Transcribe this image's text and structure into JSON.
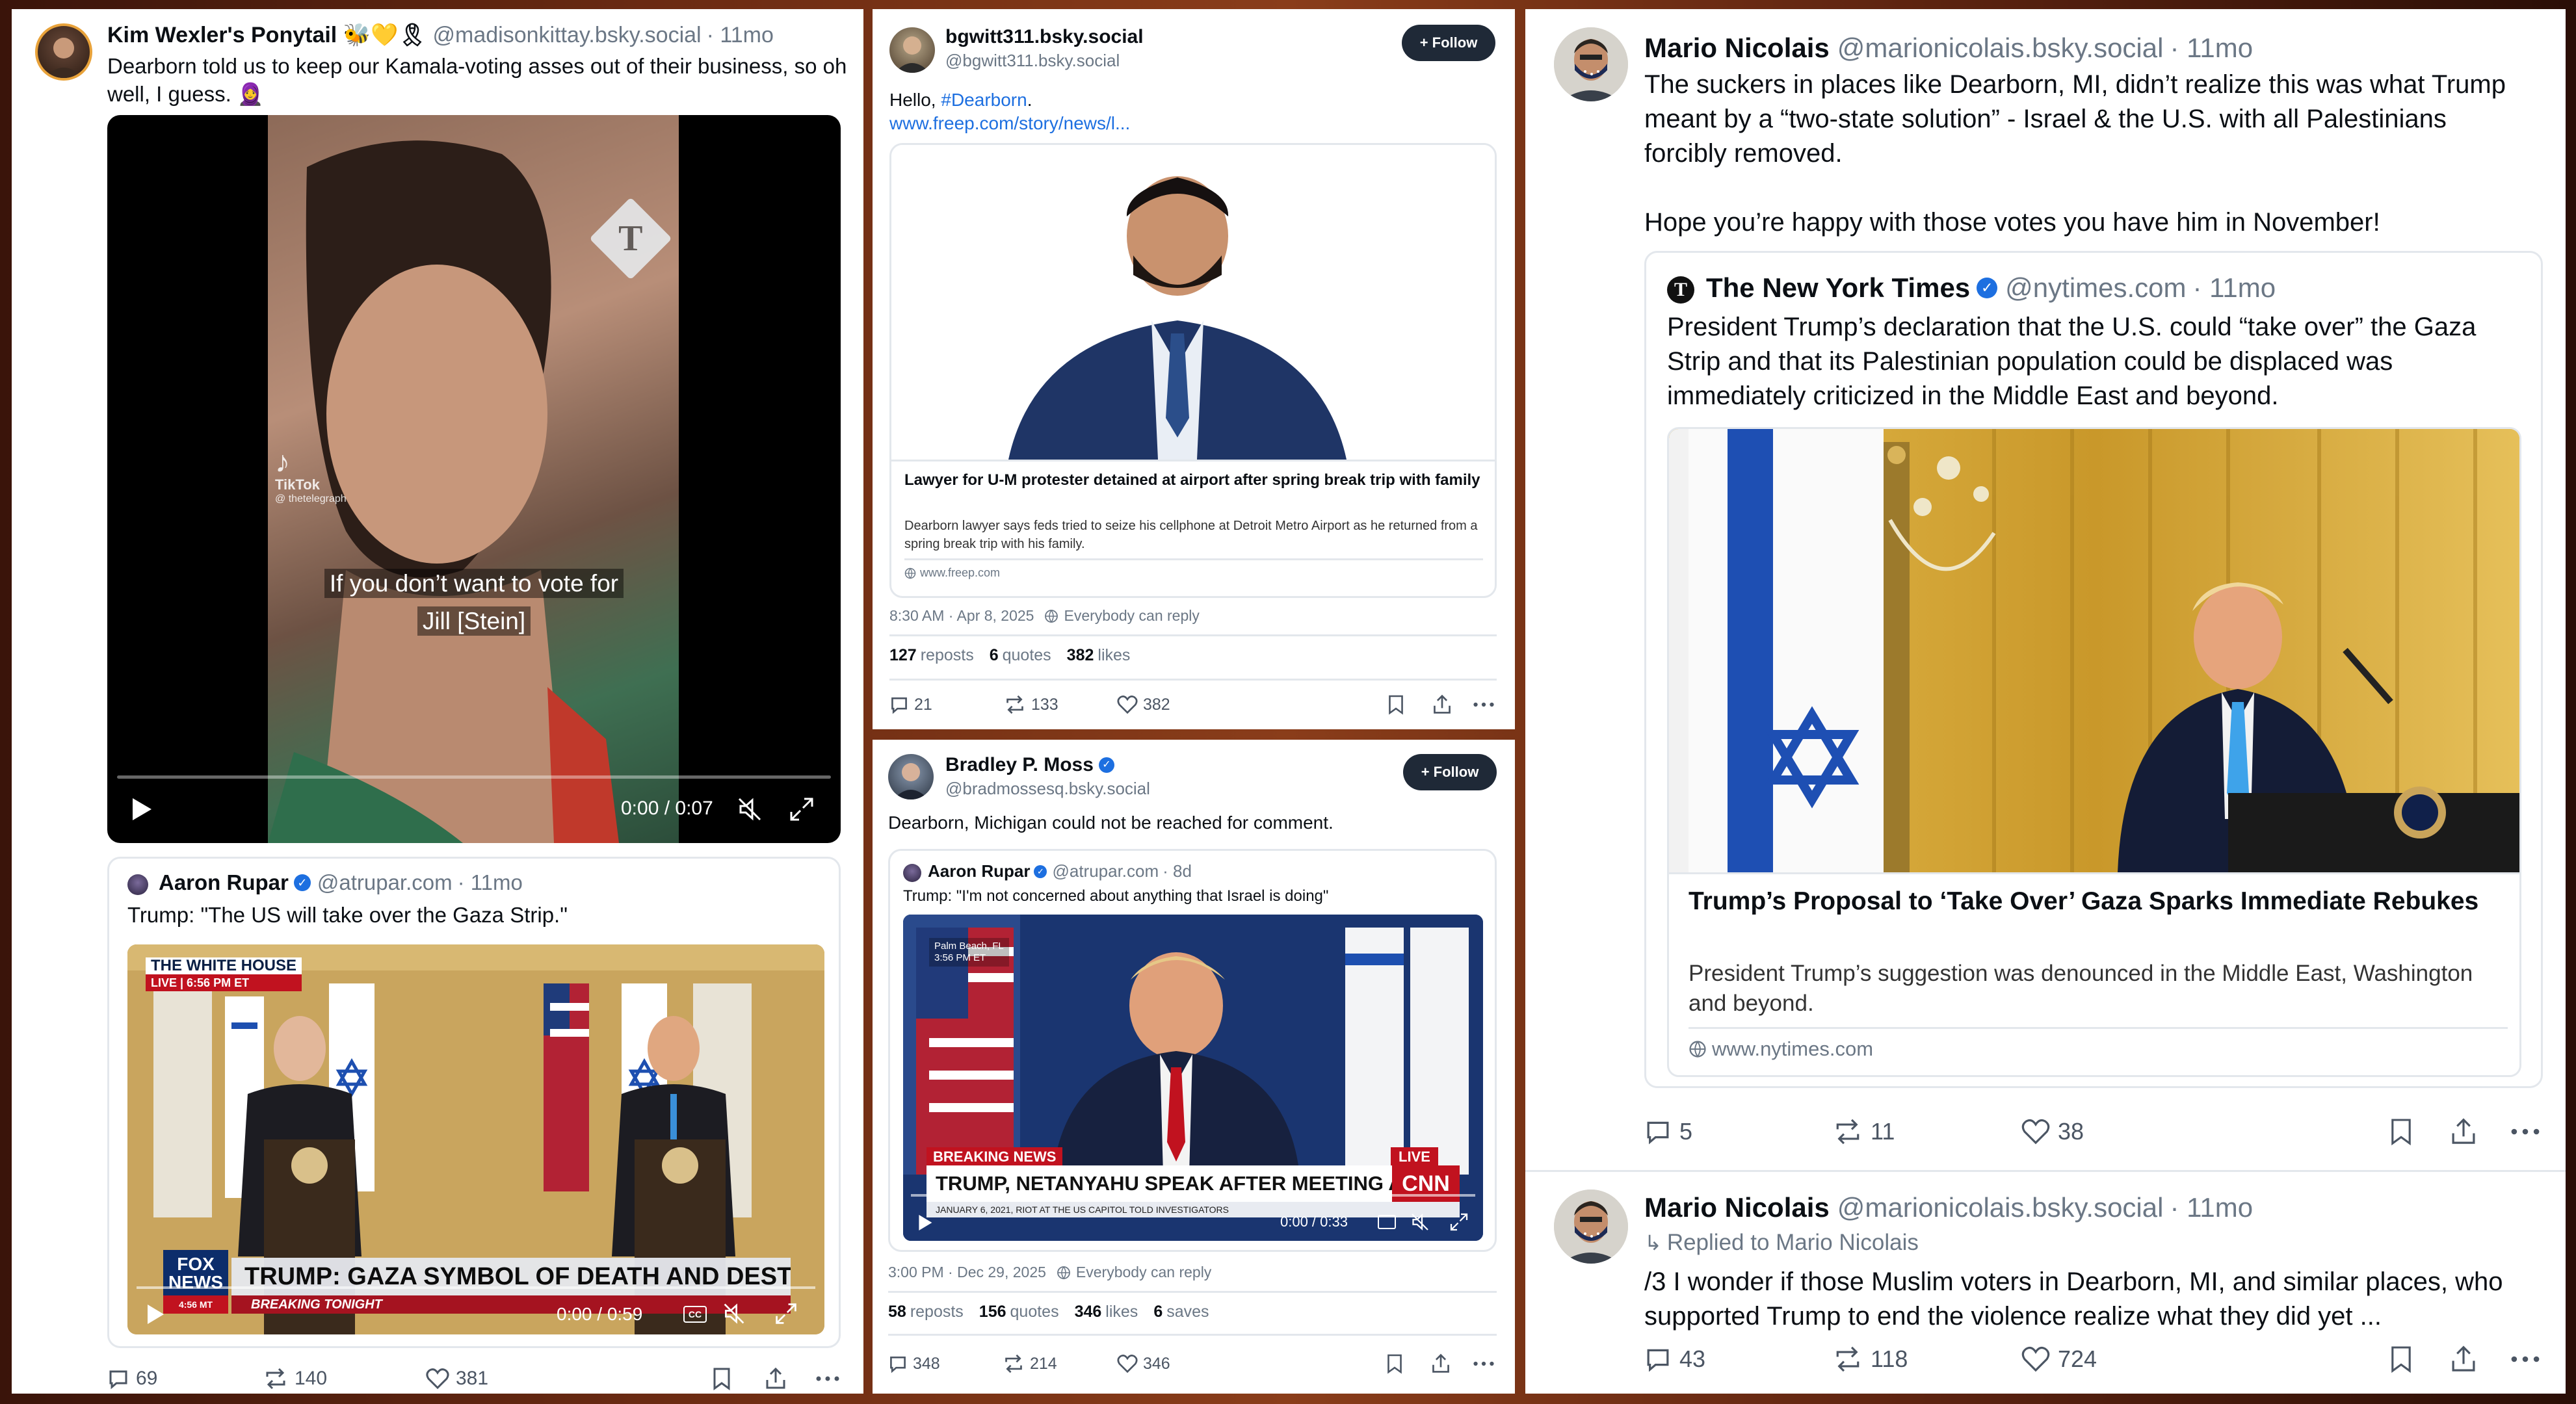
{
  "post1": {
    "author_name": "Kim Wexler's Ponytail 🐝💛🎗",
    "handle": "@madisonkittay.bsky.social",
    "time": "· 11mo",
    "text": "Dearborn told us to keep our Kamala-voting asses out of their business, so oh well, I guess. 🧕",
    "video": {
      "caption_line1": "If you don’t want to vote for",
      "caption_line2": "Jill [Stein]",
      "tiktok_label": "TikTok",
      "tiktok_user": "@ thetelegraph",
      "time_display": "0:00 / 0:07",
      "progress_fraction": 0.0
    }
  },
  "post2": {
    "author_name": "Aaron Rupar",
    "handle": "@atrupar.com",
    "time": "· 11mo",
    "text": "Trump: \"The US will take over the Gaza Strip.\"",
    "video": {
      "chyron_top": "THE WHITE HOUSE",
      "chyron_live": "LIVE | 6:56 PM ET",
      "network": "FOX NEWS",
      "network_time": "4:56 MT",
      "headline": "TRUMP: GAZA SYMBOL OF DEATH AND DESTRUCTION",
      "ticker": "BREAKING TONIGHT",
      "time_display": "0:00 / 0:59",
      "cc": "CC"
    },
    "stats": {
      "replies": "69",
      "reposts": "140",
      "likes": "381"
    }
  },
  "post3": {
    "author_name": "bgwitt311.bsky.social",
    "handle": "@bgwitt311.bsky.social",
    "follow_label": "+ Follow",
    "text_prefix": "Hello, ",
    "hashtag": "#Dearborn",
    "text_suffix": ".",
    "link": "www.freep.com/story/news/l...",
    "card": {
      "title": "Lawyer for U-M protester detained at airport after spring break trip with family",
      "description": "Dearborn lawyer says feds tried to seize his cellphone at Detroit Metro Airport as he returned from a spring break trip with his family.",
      "domain": "www.freep.com"
    },
    "timestamp": "8:30 AM · Apr 8, 2025",
    "reply_setting": "Everybody can reply",
    "counts": {
      "reposts": "127",
      "reposts_label": "reposts",
      "quotes": "6",
      "quotes_label": "quotes",
      "likes": "382",
      "likes_label": "likes"
    },
    "stats": {
      "replies": "21",
      "reposts": "133",
      "likes": "382"
    }
  },
  "post4": {
    "author_name": "Bradley P. Moss",
    "handle": "@bradmossesq.bsky.social",
    "follow_label": "+ Follow",
    "text": "Dearborn, Michigan could not be reached for comment.",
    "quote": {
      "author_name": "Aaron Rupar",
      "handle": "@atrupar.com",
      "time": "· 8d",
      "text": "Trump: \"I'm not concerned about anything that Israel is doing\"",
      "video": {
        "location": "Palm Beach, FL",
        "location_time": "3:56 PM ET",
        "breaking": "BREAKING NEWS",
        "live": "LIVE",
        "headline": "TRUMP, NETANYAHU SPEAK AFTER MEETING AT MAR-A-LAGO",
        "network": "CNN",
        "ticker": "JANUARY 6, 2021, RIOT AT THE US CAPITOL TOLD INVESTIGATORS",
        "time_display": "0:00 / 0:33"
      }
    },
    "timestamp": "3:00 PM · Dec 29, 2025",
    "reply_setting": "Everybody can reply",
    "counts": {
      "reposts": "58",
      "reposts_label": "reposts",
      "quotes": "156",
      "quotes_label": "quotes",
      "likes": "346",
      "likes_label": "likes",
      "saves": "6",
      "saves_label": "saves"
    },
    "stats": {
      "replies": "348",
      "reposts": "214",
      "likes": "346"
    }
  },
  "post5": {
    "author_name": "Mario Nicolais",
    "handle": "@marionicolais.bsky.social",
    "time": "· 11mo",
    "text1": "The suckers in places like Dearborn, MI, didn’t realize this was what Trump meant by a “two-state solution” - Israel & the U.S. with all Palestinians forcibly removed.",
    "text2": "Hope you’re happy with those votes you have him in November!",
    "quote": {
      "author_name": "The New York Times",
      "handle": "@nytimes.com",
      "time": "· 11mo",
      "text": "President Trump’s declaration that the U.S. could “take over” the Gaza Strip and that its Palestinian population could be  displaced was immediately criticized in the Middle East and beyond.",
      "card_title": "Trump’s Proposal to ‘Take Over’ Gaza Sparks Immediate Rebukes",
      "card_description": "President Trump’s suggestion was denounced in the Middle East, Washington and beyond.",
      "card_domain": "www.nytimes.com"
    },
    "stats": {
      "replies": "5",
      "reposts": "11",
      "likes": "38"
    }
  },
  "post6": {
    "author_name": "Mario Nicolais",
    "handle": "@marionicolais.bsky.social",
    "time": "· 11mo",
    "reply_to": "Replied to Mario Nicolais",
    "text": "/3 I wonder if those Muslim voters in Dearborn, MI, and similar places, who supported Trump to end the violence realize what they did yet ...",
    "stats": {
      "replies": "43",
      "reposts": "118",
      "likes": "724"
    }
  },
  "colors": {
    "accent_blue": "#1d6fe0",
    "text": "#0b0f14",
    "muted": "#6b7785",
    "border": "#e3e7ec",
    "follow_bg": "#1f2937"
  },
  "icons": [
    "reply-icon",
    "repost-icon",
    "like-icon",
    "bookmark-icon",
    "share-icon",
    "more-icon",
    "play-icon",
    "mute-icon",
    "fullscreen-icon",
    "verified-icon",
    "globe-icon",
    "reply-arrow-icon"
  ]
}
